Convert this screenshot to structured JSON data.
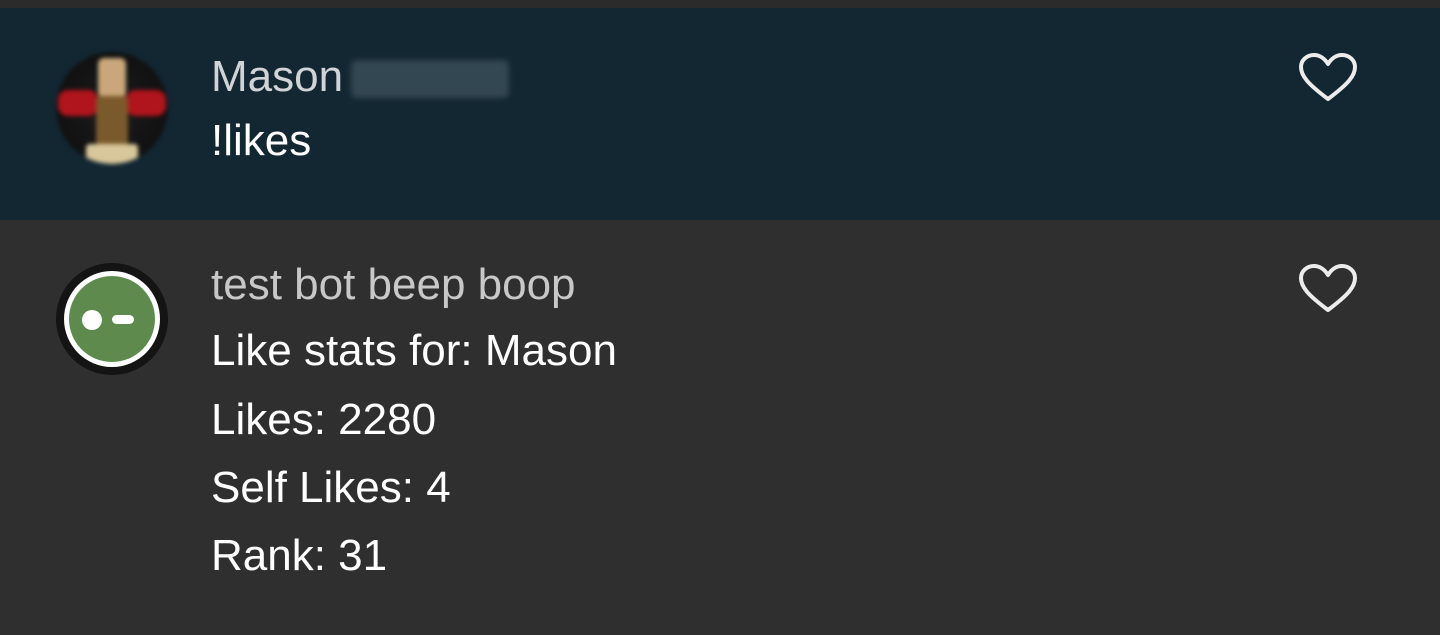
{
  "messages": [
    {
      "author": "Mason",
      "author_suffix_redacted": true,
      "avatar": "user-avatar",
      "lines": [
        "!likes"
      ],
      "highlighted": true,
      "action_icon": "heart-icon"
    },
    {
      "author": "test bot beep boop",
      "avatar": "bot-avatar",
      "lines": [
        "Like stats for: Mason",
        "Likes: 2280",
        "Self Likes: 4",
        "Rank: 31"
      ],
      "highlighted": false,
      "action_icon": "heart-icon"
    }
  ],
  "colors": {
    "background": "#2f2f2f",
    "highlight_background": "#132733",
    "bot_avatar_green": "#5e8a4e",
    "text": "#ffffff",
    "author_text": "#c8c8c8"
  }
}
